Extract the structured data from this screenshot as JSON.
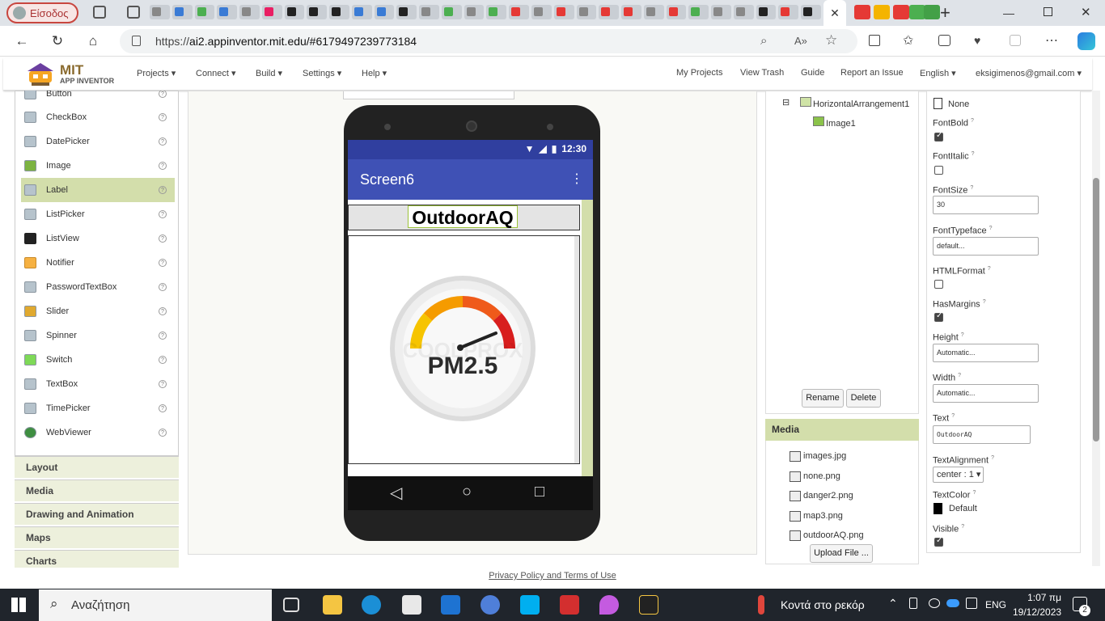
{
  "browser": {
    "profile_label": "Είσοδος",
    "url_prefix": "https://",
    "url_rest": "ai2.appinventor.mit.edu/#6179497239773184",
    "active_tab_close": "✕",
    "new_tab": "+"
  },
  "app": {
    "logo_line1": "MIT",
    "logo_line2": "APP INVENTOR",
    "menu": [
      "Projects ▾",
      "Connect ▾",
      "Build ▾",
      "Settings ▾",
      "Help ▾"
    ],
    "right_menu": [
      "My Projects",
      "View Trash",
      "Guide",
      "Report an Issue",
      "English ▾",
      "eksigimenos@gmail.com ▾"
    ]
  },
  "palette": {
    "items": [
      {
        "label": "Button",
        "icon": "button-icon"
      },
      {
        "label": "CheckBox",
        "icon": "checkbox-icon"
      },
      {
        "label": "DatePicker",
        "icon": "datepicker-icon"
      },
      {
        "label": "Image",
        "icon": "image-icon"
      },
      {
        "label": "Label",
        "icon": "label-icon"
      },
      {
        "label": "ListPicker",
        "icon": "listpicker-icon"
      },
      {
        "label": "ListView",
        "icon": "listview-icon"
      },
      {
        "label": "Notifier",
        "icon": "notifier-icon"
      },
      {
        "label": "PasswordTextBox",
        "icon": "passwordtextbox-icon"
      },
      {
        "label": "Slider",
        "icon": "slider-icon"
      },
      {
        "label": "Spinner",
        "icon": "spinner-icon"
      },
      {
        "label": "Switch",
        "icon": "switch-icon"
      },
      {
        "label": "TextBox",
        "icon": "textbox-icon"
      },
      {
        "label": "TimePicker",
        "icon": "timepicker-icon"
      },
      {
        "label": "WebViewer",
        "icon": "webviewer-icon"
      }
    ],
    "selected": "Label",
    "help": "?",
    "categories": [
      "Layout",
      "Media",
      "Drawing and Animation",
      "Maps",
      "Charts"
    ]
  },
  "viewer": {
    "time": "12:30",
    "screen_title": "Screen6",
    "overflow": "⋮",
    "label_text": "OutdoorAQ",
    "image_text": "PM2.5",
    "watermark": "COOLPROX",
    "nav_back": "◁",
    "nav_home": "○",
    "nav_recent": "□"
  },
  "components": {
    "tree_parent": "HorizontalArrangement1",
    "tree_child": "Image1",
    "collapse": "⊟",
    "rename": "Rename",
    "delete": "Delete"
  },
  "media": {
    "title": "Media",
    "files": [
      "images.jpg",
      "none.png",
      "danger2.png",
      "map3.png",
      "outdoorAQ.png"
    ],
    "upload": "Upload File ..."
  },
  "properties": {
    "help": "?",
    "top_value": "None",
    "fontbold": "FontBold",
    "fontitalic": "FontItalic",
    "fontsize": "FontSize",
    "fontsize_value": "30",
    "fonttypeface": "FontTypeface",
    "fonttypeface_value": "default...",
    "htmlformat": "HTMLFormat",
    "hasmargins": "HasMargins",
    "height": "Height",
    "height_value": "Automatic...",
    "width": "Width",
    "width_value": "Automatic...",
    "text": "Text",
    "text_value": "OutdoorAQ",
    "textalignment": "TextAlignment",
    "textalignment_value": "center : 1 ▾",
    "textcolor": "TextColor",
    "textcolor_value": "Default",
    "visible": "Visible"
  },
  "footer": {
    "privacy": "Privacy Policy and Terms of Use"
  },
  "taskbar": {
    "search": "Αναζήτηση",
    "weather": "Κοντά στο ρεκόρ",
    "lang": "ENG",
    "time": "1:07 πμ",
    "date": "19/12/2023",
    "notifications": "2"
  },
  "colors": {
    "accent": "#d3deab",
    "appbar": "#3f51b5",
    "statusbar": "#303f9f"
  }
}
